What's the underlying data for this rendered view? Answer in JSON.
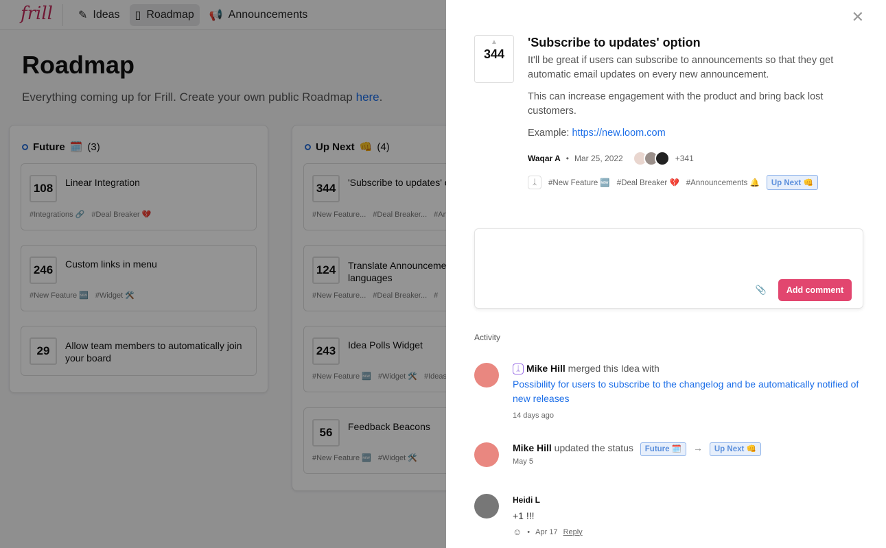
{
  "nav": {
    "logo": "frill",
    "items": [
      {
        "label": "Ideas",
        "icon": "magic-wand-icon"
      },
      {
        "label": "Roadmap",
        "icon": "map-icon",
        "active": true
      },
      {
        "label": "Announcements",
        "icon": "megaphone-icon"
      }
    ]
  },
  "page": {
    "title": "Roadmap",
    "subtitle": "Everything coming up for Frill. Create your own public Roadmap ",
    "subtitle_link": "here",
    "subtitle_end": "."
  },
  "columns": [
    {
      "name": "Future",
      "emoji": "🗓️",
      "count": "(3)",
      "cards": [
        {
          "votes": "108",
          "title": "Linear Integration",
          "tags": [
            "#Integrations 🔗",
            "#Deal Breaker 💔"
          ]
        },
        {
          "votes": "246",
          "title": "Custom links in menu",
          "tags": [
            "#New Feature 🆕",
            "#Widget 🛠️"
          ]
        },
        {
          "votes": "29",
          "title": "Allow team members to automatically join your board",
          "tags": []
        }
      ]
    },
    {
      "name": "Up Next",
      "emoji": "👊",
      "count": "(4)",
      "cards": [
        {
          "votes": "344",
          "title": "'Subscribe to updates' option",
          "tags": [
            "#New Feature...",
            "#Deal Breaker...",
            "#Announcements"
          ]
        },
        {
          "votes": "124",
          "title": "Translate Announcements into other languages",
          "tags": [
            "#New Feature...",
            "#Deal Breaker...",
            "#"
          ]
        },
        {
          "votes": "243",
          "title": "Idea Polls Widget",
          "tags": [
            "#New Feature 🆕",
            "#Widget 🛠️",
            "#Ideas"
          ]
        },
        {
          "votes": "56",
          "title": "Feedback Beacons",
          "tags": [
            "#New Feature 🆕",
            "#Widget 🛠️"
          ]
        }
      ]
    }
  ],
  "panel": {
    "votes": "344",
    "title": "'Subscribe to updates' option",
    "body1": "It'll be great if users can subscribe to announcements so that they get automatic email updates on every new announcement.",
    "body2": "This can increase engagement with the product and bring back lost customers.",
    "body3": "Example: ",
    "link": "https://new.loom.com",
    "author": "Waqar A",
    "date": "Mar 25, 2022",
    "voters_more": "+341",
    "tags": [
      "#New Feature 🆕",
      "#Deal Breaker 💔",
      "#Announcements 🔔"
    ],
    "status": "Up Next 👊",
    "add_comment": "Add comment",
    "activity_label": "Activity",
    "activity": [
      {
        "user": "Mike Hill",
        "text": " merged this Idea with",
        "link": "Possibility for users to subscribe to the changelog and be automatically notified of new releases",
        "time": "14 days ago"
      },
      {
        "user": "Mike Hill",
        "text": " updated the status",
        "from": "Future 🗓️",
        "to": "Up Next 👊",
        "time": "May 5"
      },
      {
        "user": "Heidi L",
        "comment": "+1 !!!",
        "time": "Apr 17",
        "reply": "Reply"
      }
    ]
  },
  "colors": {
    "accent": "#e2466f",
    "link": "#1d6fe8",
    "badge": "#5b8fdc"
  }
}
